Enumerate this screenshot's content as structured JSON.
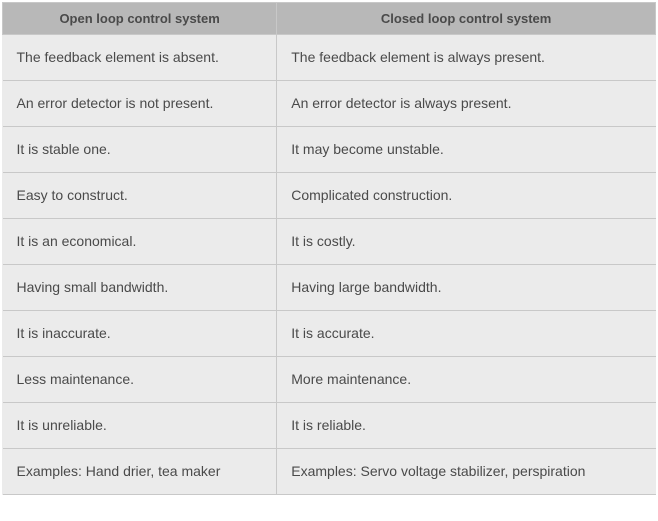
{
  "chart_data": {
    "type": "table",
    "title": "",
    "headers": [
      "Open loop control system",
      "Closed loop control system"
    ],
    "rows": [
      {
        "open": "The feedback element is absent.",
        "closed": "The feedback element is always present."
      },
      {
        "open": "An error detector is not present.",
        "closed": "An error detector is always present."
      },
      {
        "open": "It is stable one.",
        "closed": "It may become unstable."
      },
      {
        "open": "Easy to construct.",
        "closed": "Complicated construction."
      },
      {
        "open": "It is an economical.",
        "closed": "It is costly."
      },
      {
        "open": "Having small bandwidth.",
        "closed": "Having large bandwidth."
      },
      {
        "open": "It is inaccurate.",
        "closed": "It is accurate."
      },
      {
        "open": "Less maintenance.",
        "closed": "More maintenance."
      },
      {
        "open": "It is unreliable.",
        "closed": "It is reliable."
      },
      {
        "open": "Examples: Hand drier, tea maker",
        "closed": "Examples: Servo voltage stabilizer, perspiration"
      }
    ]
  }
}
